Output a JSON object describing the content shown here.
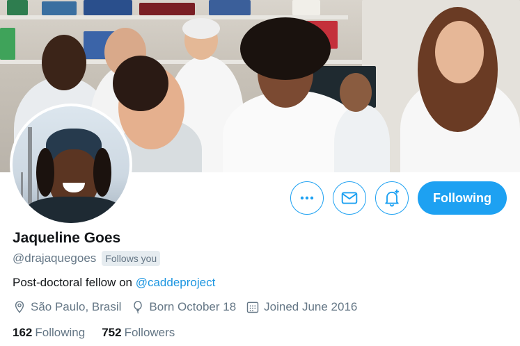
{
  "profile": {
    "name": "Jaqueline Goes",
    "handle": "@drajaquegoes",
    "follows_you": "Follows you",
    "bio_prefix": "Post-doctoral fellow on ",
    "bio_link": "@caddeproject",
    "location": "São Paulo, Brasil",
    "birthday": "Born October 18",
    "joined": "Joined June 2016"
  },
  "stats": {
    "following_count": "162",
    "following_label": "Following",
    "followers_count": "752",
    "followers_label": "Followers"
  },
  "actions": {
    "follow_label": "Following",
    "more_icon": "more-icon",
    "message_icon": "envelope-icon",
    "notify_icon": "bell-plus-icon"
  },
  "colors": {
    "accent": "#1da1f2",
    "link": "#1b95e0",
    "secondary_text": "#657786",
    "primary_text": "#14171a"
  }
}
